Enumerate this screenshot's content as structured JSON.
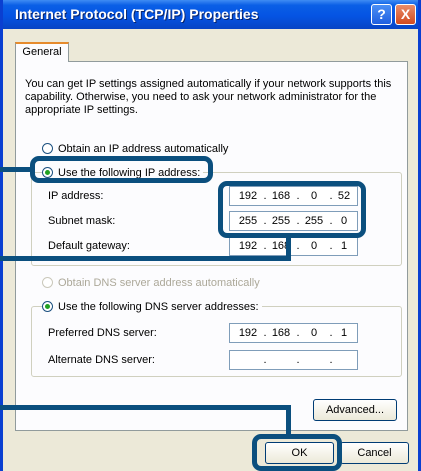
{
  "window": {
    "title": "Internet Protocol (TCP/IP) Properties",
    "help_label": "?",
    "close_label": "X"
  },
  "tabs": [
    {
      "label": "General",
      "selected": true
    }
  ],
  "intro_text": "You can get IP settings assigned automatically if your network supports this capability. Otherwise, you need to ask your network administrator for the appropriate IP settings.",
  "ip_mode": {
    "auto_label": "Obtain an IP address automatically",
    "auto_selected": false,
    "manual_label": "Use the following IP address:",
    "manual_selected": true
  },
  "ip_fields": [
    {
      "label": "IP address:",
      "octets": [
        "192",
        "168",
        "0",
        "52"
      ]
    },
    {
      "label": "Subnet mask:",
      "octets": [
        "255",
        "255",
        "255",
        "0"
      ]
    },
    {
      "label": "Default gateway:",
      "octets": [
        "192",
        "168",
        "0",
        "1"
      ]
    }
  ],
  "dns_mode": {
    "auto_label": "Obtain DNS server address automatically",
    "auto_selected": false,
    "auto_disabled": true,
    "manual_label": "Use the following DNS server addresses:",
    "manual_selected": true
  },
  "dns_fields": [
    {
      "label": "Preferred DNS server:",
      "octets": [
        "192",
        "168",
        "0",
        "1"
      ]
    },
    {
      "label": "Alternate DNS server:",
      "octets": [
        "",
        "",
        "",
        ""
      ]
    }
  ],
  "buttons": {
    "advanced": "Advanced...",
    "ok": "OK",
    "cancel": "Cancel"
  },
  "colors": {
    "titlebar": "#0554e3",
    "dialog_face": "#ece9d8",
    "callout": "#0b4f7e"
  },
  "icons": {
    "help": "help-icon",
    "close": "close-icon"
  }
}
